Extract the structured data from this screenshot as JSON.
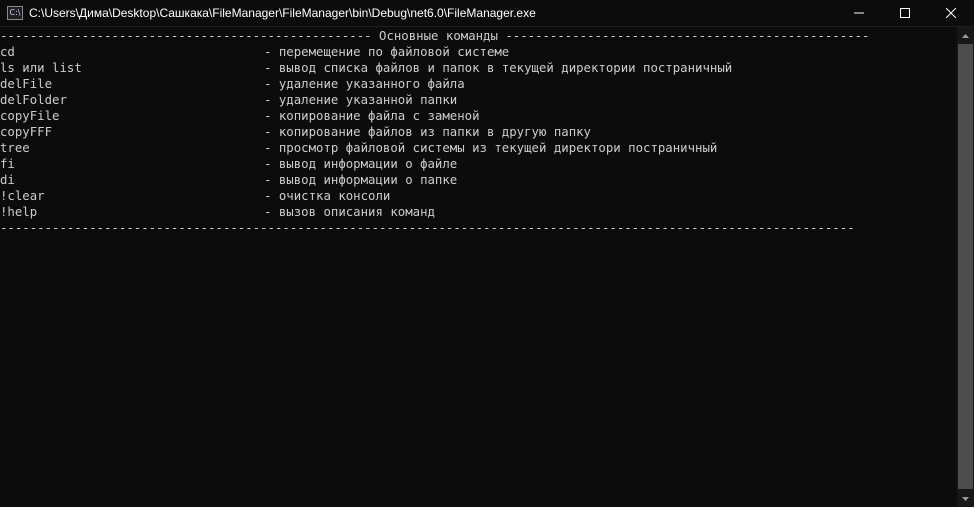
{
  "window": {
    "title": "C:\\Users\\Дима\\Desktop\\Сашкака\\FileManager\\FileManager\\bin\\Debug\\net6.0\\FileManager.exe",
    "icon": "console-app-icon",
    "icon_text": "C:\\",
    "buttons": [
      "minimize-icon",
      "maximize-icon",
      "close-icon"
    ]
  },
  "console": {
    "header_line": "-------------------------------------------------- Основные команды -------------------------------------------------",
    "commands": [
      {
        "cmd": "cd",
        "desc": "- перемещение по файловой системе"
      },
      {
        "cmd": "ls или list",
        "desc": "- вывод списка файлов и папок в текущей директории постраничный"
      },
      {
        "cmd": "delFile",
        "desc": "- удаление указанного файла"
      },
      {
        "cmd": "delFolder",
        "desc": "- удаление указанной папки"
      },
      {
        "cmd": "copyFile",
        "desc": "- копирование файла с заменой"
      },
      {
        "cmd": "copyFFF",
        "desc": "- копирование файлов из папки в другую папку"
      },
      {
        "cmd": "tree",
        "desc": "- просмотр файловой системы из текущей директори постраничный"
      },
      {
        "cmd": "fi",
        "desc": "- вывод информации о файле"
      },
      {
        "cmd": "di",
        "desc": "- вывод информации о папке"
      },
      {
        "cmd": "!clear",
        "desc": "- очистка консоли"
      },
      {
        "cmd": "!help",
        "desc": "- вызов описания команд"
      }
    ],
    "footer_line": "-------------------------------------------------------------------------------------------------------------------",
    "text_color": "#cccccc",
    "background_color": "#0c0c0c"
  }
}
